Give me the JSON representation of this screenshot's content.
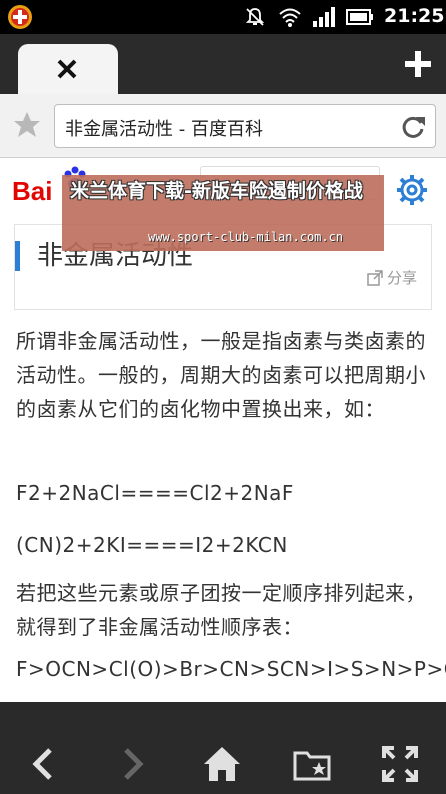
{
  "status_bar": {
    "time": "21:25",
    "icons": [
      "app-notification-icon",
      "mute-icon",
      "wifi-icon",
      "signal-icon",
      "battery-icon"
    ]
  },
  "tabs": {
    "close_icon": "close-icon",
    "new_tab_icon": "plus-icon"
  },
  "address_bar": {
    "page_title": "非金属活动性 - 百度百科"
  },
  "baidu": {
    "logo_text": "Bai"
  },
  "article": {
    "heading": "非金属活动性",
    "share_label": "分享",
    "paragraphs": [
      "所谓非金属活动性，一般是指卤素与类卤素的活动性。一般的，周期大的卤素可以把周期小的卤素从它们的卤化物中置换出来，如：",
      "F2+2NaCl====Cl2+2NaF",
      "(CN)2+2KI====I2+2KCN",
      "若把这些元素或原子团按一定顺序排列起来，就得到了非金属活动性顺序表：",
      "F>OCN>Cl(O)>Br>CN>SCN>I>S>N>P>C>Si>H"
    ]
  },
  "watermark": {
    "title": "米兰体育下载-新版车险遏制价格战",
    "url": "www.sport-club-milan.com.cn"
  },
  "colors": {
    "baidu_red": "#e10601",
    "baidu_blue": "#2932e1",
    "accent_blue": "#2d7fd5",
    "toolbar_bg": "#2a2a2a"
  }
}
